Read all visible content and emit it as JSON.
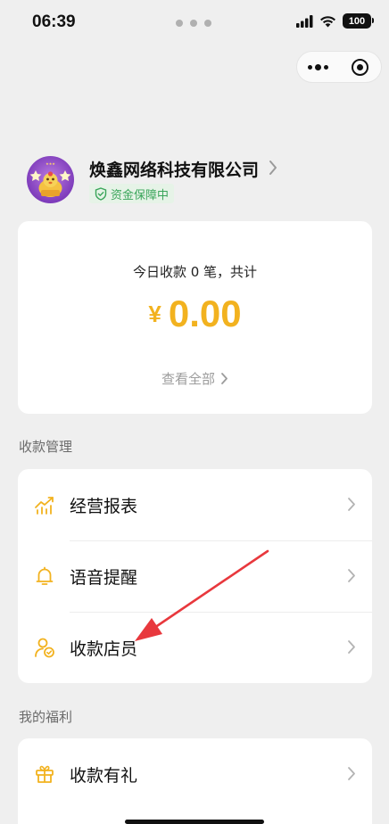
{
  "status_bar": {
    "time": "06:39",
    "battery": "100"
  },
  "merchant": {
    "name": "焕鑫网络科技有限公司",
    "guarantee": "资金保障中"
  },
  "summary": {
    "today_text": "今日收款 0 笔，共计",
    "currency": "¥",
    "amount": "0.00",
    "view_all": "查看全部"
  },
  "sections": {
    "management": "收款管理",
    "benefits": "我的福利"
  },
  "menu": {
    "report": "经营报表",
    "voice": "语音提醒",
    "staff": "收款店员",
    "gift": "收款有礼"
  },
  "colors": {
    "accent": "#f2b21f",
    "guarantee": "#3aa55a",
    "annotation": "#e8383d"
  }
}
